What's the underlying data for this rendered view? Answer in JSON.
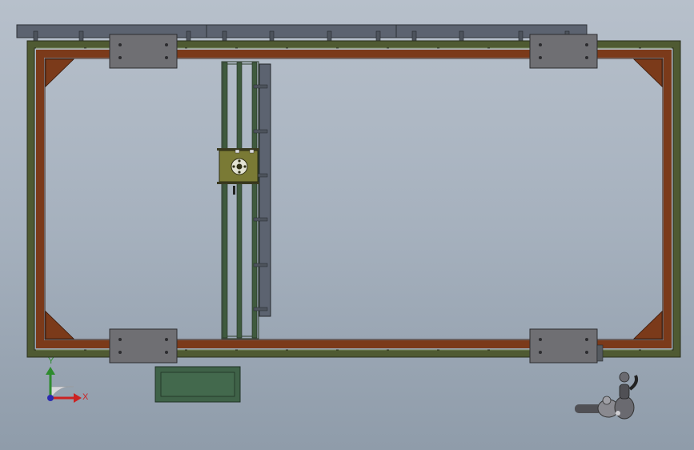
{
  "viewport": {
    "background_top": "#b7c0cb",
    "background_bottom": "#8f9caa"
  },
  "colors": {
    "frame_wood": "#7b3a1a",
    "frame_green": "#4f5a32",
    "rail_green": "#3f5a3e",
    "plate_gray": "#6f6f73",
    "carriage": "#7a7a35",
    "panel_box": "#3f6248",
    "bar_gray": "#5c6370"
  },
  "triad": {
    "y_label": "Y",
    "x_label": "X",
    "y_color": "#2e8b2e",
    "x_color": "#cc2222",
    "icon": "coordinate-triad-icon"
  },
  "orientation_widget": {
    "icon": "view-orientation-arm-icon"
  }
}
